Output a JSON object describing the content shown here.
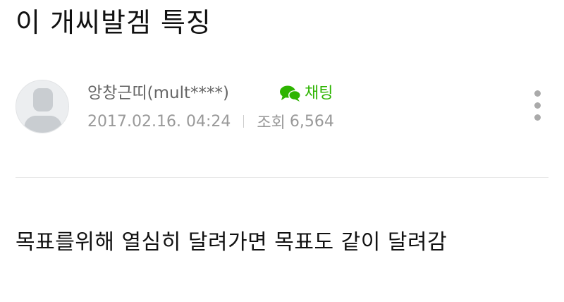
{
  "post": {
    "title": "이 개씨발겜 특징",
    "body": "목표를위해 열심히 달려가면 목표도 같이 달려감"
  },
  "author": {
    "name": "앙창근띠(mult****)",
    "avatar_icon": "default-user-silhouette-icon"
  },
  "chat": {
    "label": "채팅",
    "icon": "speech-bubbles-icon",
    "color": "#2db400"
  },
  "meta": {
    "date": "2017.02.16. 04:24",
    "views_label": "조회",
    "views_count": "6,564"
  },
  "more_menu": {
    "icon": "vertical-ellipsis-icon"
  }
}
